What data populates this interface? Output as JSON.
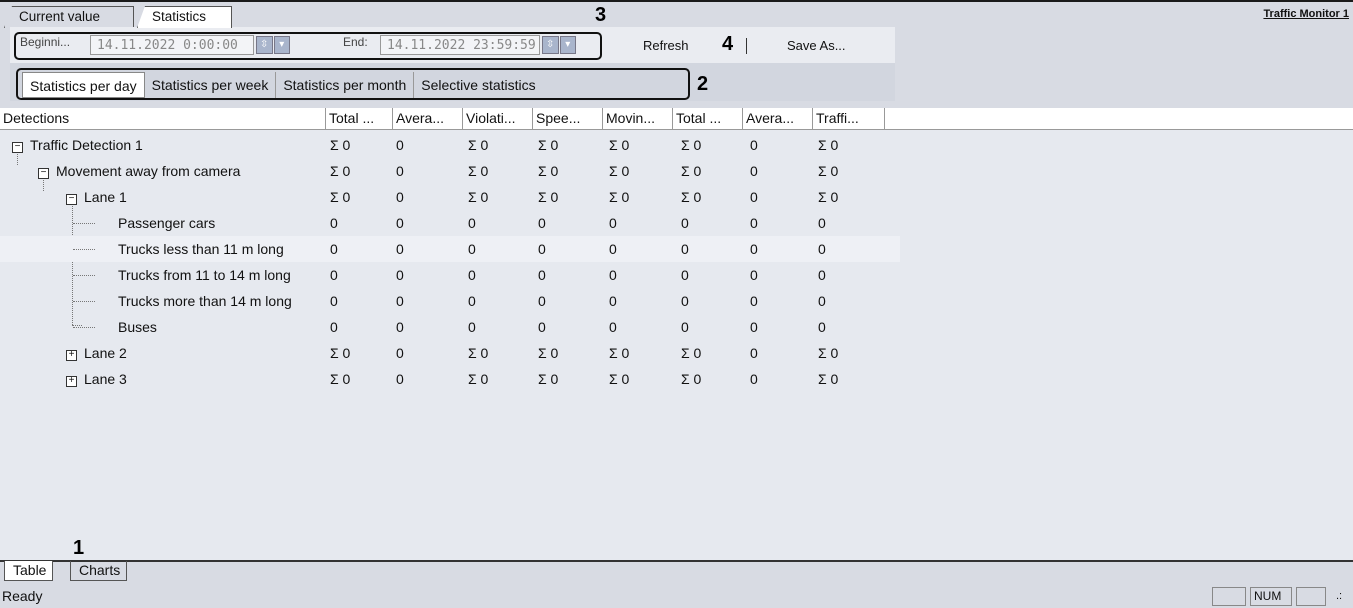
{
  "tabs": {
    "current_value": "Current value",
    "statistics": "Statistics"
  },
  "window_title": "Traffic Monitor 1",
  "annotations": {
    "a1": "1",
    "a2": "2",
    "a3": "3",
    "a4": "4"
  },
  "period": {
    "begin_label": "Beginni...",
    "begin_value": "14.11.2022 0:00:00",
    "end_label": "End:",
    "end_value": "14.11.2022 23:59:59"
  },
  "toolbar": {
    "refresh": "Refresh",
    "save_as": "Save As..."
  },
  "view_tabs": [
    "Statistics per day",
    "Statistics per week",
    "Statistics per month",
    "Selective statistics"
  ],
  "table": {
    "columns": [
      "Detections",
      "Total ...",
      "Avera...",
      "Violati...",
      "Spee...",
      "Movin...",
      "Total ...",
      "Avera...",
      "Traffi..."
    ],
    "rows": [
      {
        "name": "Traffic Detection 1",
        "exp": "−",
        "vals": [
          "Σ 0",
          "0",
          "Σ 0",
          "Σ 0",
          "Σ 0",
          "Σ 0",
          "0",
          "Σ 0"
        ]
      },
      {
        "name": "Movement away from camera",
        "exp": "−",
        "vals": [
          "Σ 0",
          "0",
          "Σ 0",
          "Σ 0",
          "Σ 0",
          "Σ 0",
          "0",
          "Σ 0"
        ]
      },
      {
        "name": "Lane 1",
        "exp": "−",
        "vals": [
          "Σ 0",
          "0",
          "Σ 0",
          "Σ 0",
          "Σ 0",
          "Σ 0",
          "0",
          "Σ 0"
        ]
      },
      {
        "name": "Passenger cars",
        "exp": "",
        "vals": [
          "0",
          "0",
          "0",
          "0",
          "0",
          "0",
          "0",
          "0"
        ]
      },
      {
        "name": "Trucks less than 11 m long",
        "exp": "",
        "vals": [
          "0",
          "0",
          "0",
          "0",
          "0",
          "0",
          "0",
          "0"
        ]
      },
      {
        "name": "Trucks from 11 to 14 m long",
        "exp": "",
        "vals": [
          "0",
          "0",
          "0",
          "0",
          "0",
          "0",
          "0",
          "0"
        ]
      },
      {
        "name": "Trucks more than 14 m long",
        "exp": "",
        "vals": [
          "0",
          "0",
          "0",
          "0",
          "0",
          "0",
          "0",
          "0"
        ]
      },
      {
        "name": "Buses",
        "exp": "",
        "vals": [
          "0",
          "0",
          "0",
          "0",
          "0",
          "0",
          "0",
          "0"
        ]
      },
      {
        "name": "Lane 2",
        "exp": "+",
        "vals": [
          "Σ 0",
          "0",
          "Σ 0",
          "Σ 0",
          "Σ 0",
          "Σ 0",
          "0",
          "Σ 0"
        ]
      },
      {
        "name": "Lane 3",
        "exp": "+",
        "vals": [
          "Σ 0",
          "0",
          "Σ 0",
          "Σ 0",
          "Σ 0",
          "Σ 0",
          "0",
          "Σ 0"
        ]
      }
    ]
  },
  "bottom_tabs": [
    "Table",
    "Charts"
  ],
  "status": {
    "text": "Ready",
    "num": "NUM"
  },
  "icons": {
    "spin": "spin-updown-icon",
    "dropdown": "dropdown-arrow-icon",
    "expand": "tree-expander-icon",
    "grip": "resize-grip-icon"
  }
}
